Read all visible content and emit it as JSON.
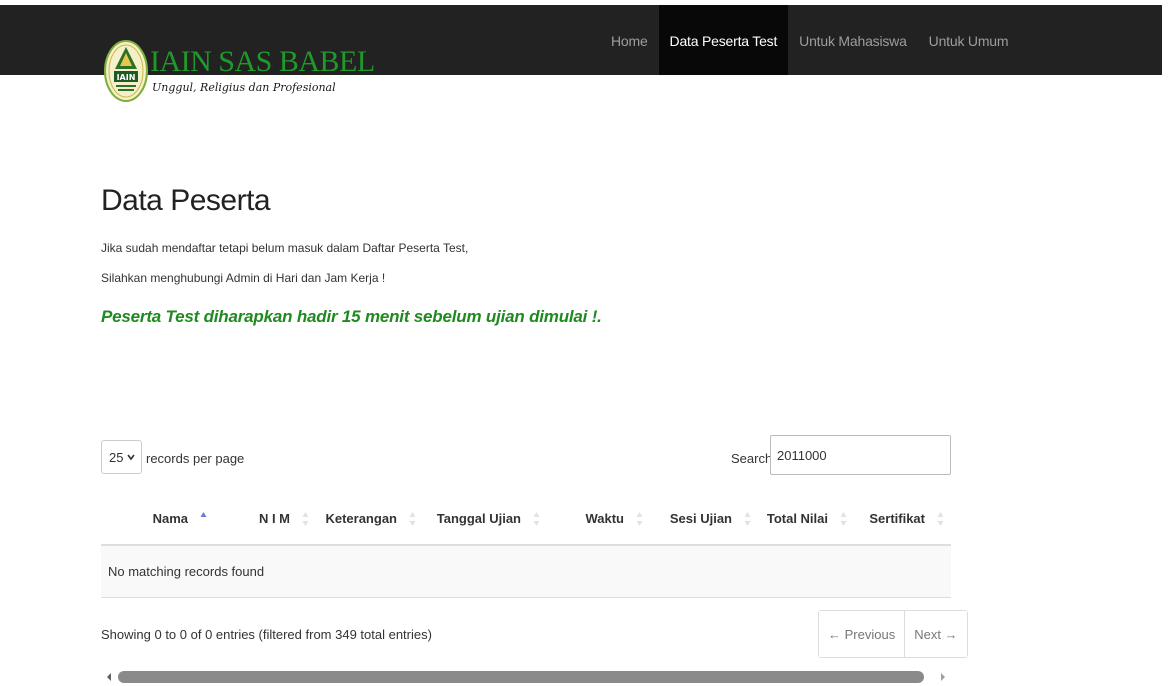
{
  "brand": {
    "name": "IAIN SAS BABEL",
    "tagline": "Unggul, Religius dan Profesional",
    "logo_text": "IAIN",
    "primary_color": "#1f9a2a"
  },
  "nav": {
    "items": [
      {
        "label": "Home",
        "active": false
      },
      {
        "label": "Data Peserta Test",
        "active": true
      },
      {
        "label": "Untuk Mahasiswa",
        "active": false
      },
      {
        "label": "Untuk Umum",
        "active": false
      }
    ]
  },
  "content": {
    "title": "Data Peserta",
    "info_line1": "Jika sudah mendaftar tetapi belum masuk dalam Daftar Peserta Test,",
    "info_line2": "Silahkan menghubungi Admin di Hari dan Jam Kerja !",
    "notice": "Peserta Test diharapkan hadir 15 menit sebelum ujian dimulai !.",
    "notice_color": "#1f8a1f"
  },
  "table_controls": {
    "length_value": "25",
    "length_label": "records per page",
    "search_label": "Search:",
    "search_value": "2011000"
  },
  "table": {
    "columns": [
      "Nama",
      "N I M",
      "Keterangan",
      "Tanggal Ujian",
      "Waktu",
      "Sesi Ujian",
      "Total Nilai",
      "Sertifikat"
    ],
    "empty_message": "No matching records found"
  },
  "footer": {
    "info": "Showing 0 to 0 of 0 entries (filtered from 349 total entries)",
    "previous": "← Previous",
    "next": "Next →"
  }
}
